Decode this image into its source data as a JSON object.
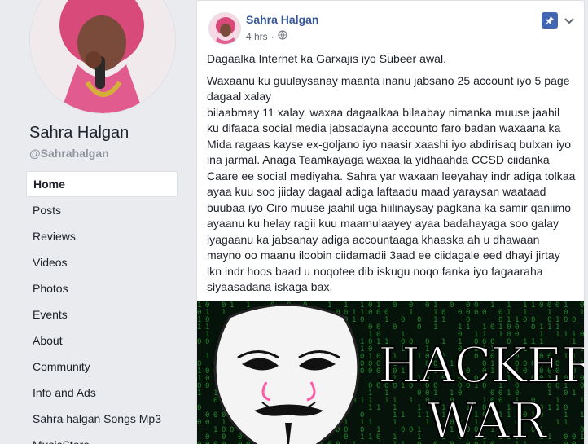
{
  "page": {
    "name": "Sahra Halgan",
    "handle": "@Sahrahalgan"
  },
  "nav": {
    "items": [
      {
        "label": "Home",
        "active": true
      },
      {
        "label": "Posts"
      },
      {
        "label": "Reviews"
      },
      {
        "label": "Videos"
      },
      {
        "label": "Photos"
      },
      {
        "label": "Events"
      },
      {
        "label": "About"
      },
      {
        "label": "Community"
      },
      {
        "label": "Info and Ads"
      },
      {
        "label": "Sahra halgan Songs Mp3"
      },
      {
        "label": "MusicStore"
      }
    ]
  },
  "post": {
    "author": "Sahra Halgan",
    "time": "4 hrs",
    "audience_icon": "globe-icon",
    "pin_icon": "pin-icon",
    "menu_icon": "chevron-down-icon",
    "paragraph1": "Dagaalka Internet ka Garxajis iyo Subeer awal.",
    "lines": [
      "Waxaanu ku guulaysanay maanta inanu jabsano 25 account iyo 5 page",
      "dagaal xalay",
      "bilaabmay 11 xalay. waxaa dagaalkaa bilaabay nimanka muuse jaahil",
      "ku difaaca social media jabsadayna accounto faro badan waxaana ka",
      "Mida ragaas kayse ex-goljano iyo naasir xaashi iyo abdirisaq bulxan iyo",
      "ina jarmal. Anaga Teamkayaga waxaa la yidhaahda CCSD ciidanka",
      "Caare ee social mediyaha. Sahra yar waxaan leeyahay indr adiga tolkaa",
      "ayaa kuu soo jiiday dagaal adiga laftaadu maad yaraysan waataad",
      "buubaa iyo Ciro muuse jaahil uga hiilinaysay pagkana ka samir qaniimo",
      "ayaanu ku helay ragii kuu maamulaayey ayaa badahayaga soo galay",
      "iyagaanu ka jabsanay adiga accountaaga khaaska ah u dhawaan",
      "mayno oo maanu iloobin ciidamadii 3aad ee ciidagale eed dhayi jirtay",
      "lkn indr hoos baad u noqotee dib iskugu noqo fanka iyo fagaaraha",
      "siyaasadana iskaga bax."
    ],
    "image": {
      "text_line1": "HACKER",
      "text_line2": "WAR",
      "colors": {
        "background": "#06130a",
        "matrix": "#2fae3c",
        "text": "#ffffff"
      }
    }
  },
  "colors": {
    "page_bg": "#e9ebee",
    "link": "#385898",
    "accent": "#4267b2"
  }
}
